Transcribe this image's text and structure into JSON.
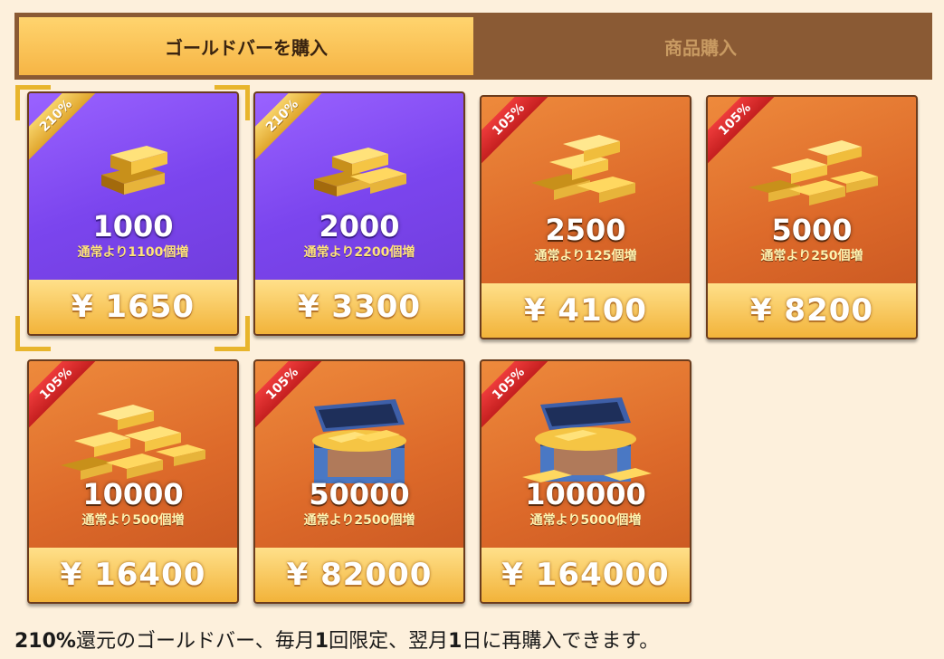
{
  "tabs": [
    {
      "label": "ゴールドバーを購入",
      "active": true
    },
    {
      "label": "商品購入",
      "active": false
    }
  ],
  "cards": [
    {
      "badge": "210%",
      "amount": "1000",
      "bonus": "通常より1100個増",
      "price": "¥ 1650",
      "theme": "purple",
      "art": "gold-bars-small-icon",
      "selected": true
    },
    {
      "badge": "210%",
      "amount": "2000",
      "bonus": "通常より2200個増",
      "price": "¥ 3300",
      "theme": "purple",
      "art": "gold-bars-medium-icon",
      "selected": false
    },
    {
      "badge": "105%",
      "amount": "2500",
      "bonus": "通常より125個増",
      "price": "¥ 4100",
      "theme": "orange",
      "art": "gold-bars-stack-icon",
      "selected": false
    },
    {
      "badge": "105%",
      "amount": "5000",
      "bonus": "通常より250個増",
      "price": "¥ 8200",
      "theme": "orange",
      "art": "gold-bars-pile-icon",
      "selected": false
    },
    {
      "badge": "105%",
      "amount": "10000",
      "bonus": "通常より500個増",
      "price": "¥ 16400",
      "theme": "orange",
      "art": "gold-bars-heap-icon",
      "selected": false
    },
    {
      "badge": "105%",
      "amount": "50000",
      "bonus": "通常より2500個増",
      "price": "¥ 82000",
      "theme": "orange",
      "art": "treasure-chest-icon",
      "selected": false
    },
    {
      "badge": "105%",
      "amount": "100000",
      "bonus": "通常より5000個増",
      "price": "¥ 164000",
      "theme": "orange",
      "art": "treasure-chest-large-icon",
      "selected": false
    }
  ],
  "footer": {
    "bold_prefix": "210%",
    "text": "還元のゴールドバー、毎月",
    "bold_1": "1",
    "text_2": "回限定、翌月",
    "bold_2": "1",
    "text_3": "日に再購入できます。"
  },
  "colors": {
    "background": "#fdf0dc",
    "tab_bar": "#8a5a34",
    "tab_active": "#f6b545",
    "card_purple": "#7b45ee",
    "card_orange": "#dd6a2a",
    "ribbon_red": "#c41f1f",
    "ribbon_gold": "#e0a52c",
    "price_gold": "#f2b33a"
  }
}
